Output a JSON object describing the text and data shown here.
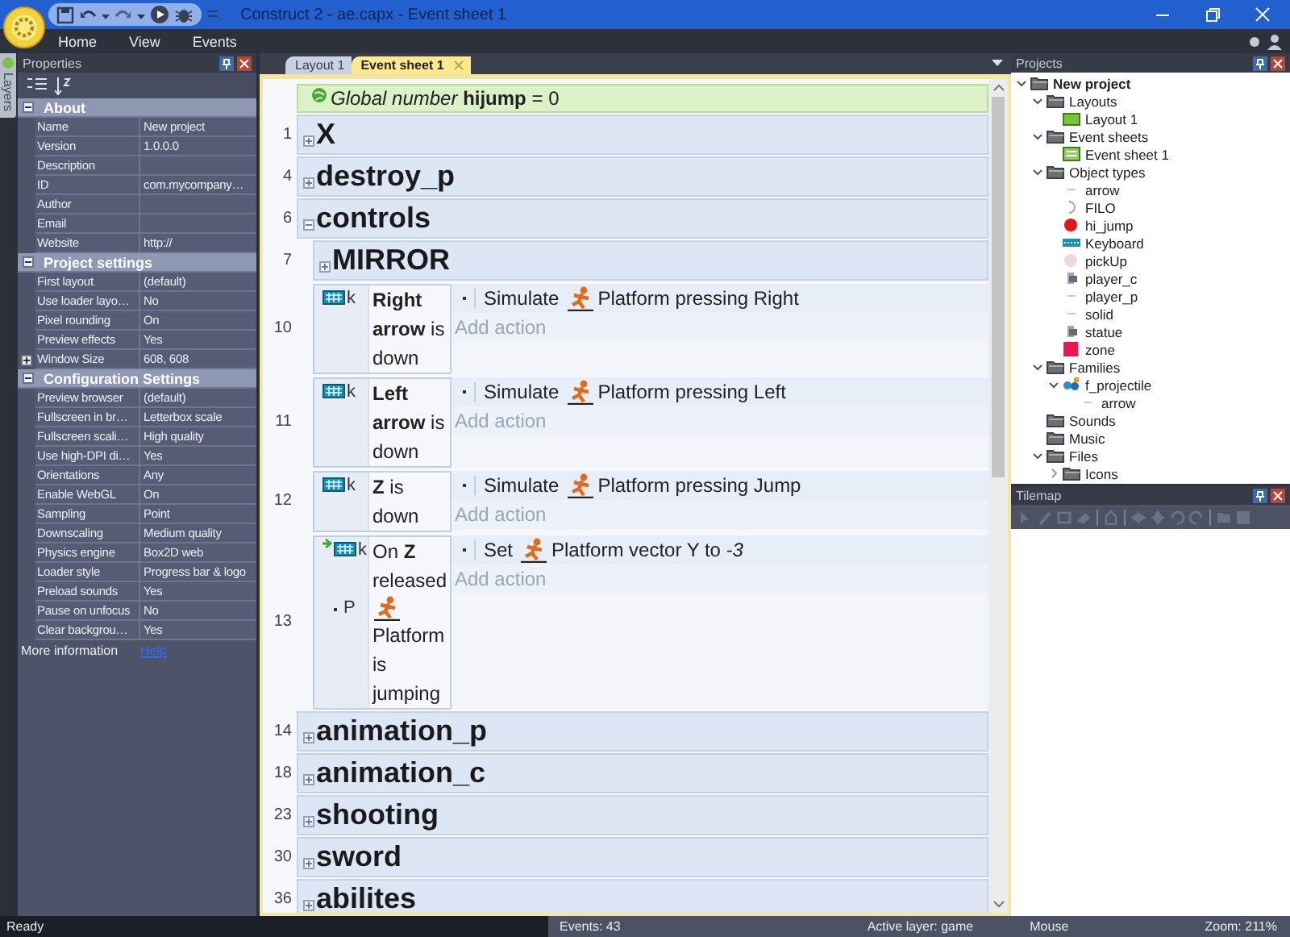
{
  "title_bar": {
    "title": "Construct 2 - ae.capx - Event sheet 1"
  },
  "menu": [
    "Home",
    "View",
    "Events"
  ],
  "side_tab": "Layers",
  "properties": {
    "title": "Properties",
    "sections": [
      {
        "title": "About",
        "expanded": true,
        "rows": [
          {
            "name": "Name",
            "value": "New project"
          },
          {
            "name": "Version",
            "value": "1.0.0.0"
          },
          {
            "name": "Description"
          },
          {
            "name": "ID",
            "value": "com.mycompany…"
          },
          {
            "name": "Author"
          },
          {
            "name": "Email"
          },
          {
            "name": "Website",
            "value": "http://"
          }
        ]
      },
      {
        "title": "Project settings",
        "expanded": true,
        "rows": [
          {
            "name": "First layout",
            "value": "(default)"
          },
          {
            "name": "Use loader layo…",
            "value": "No"
          },
          {
            "name": "Pixel rounding",
            "value": "On"
          },
          {
            "name": "Preview effects",
            "value": "Yes"
          },
          {
            "name": "Window Size",
            "value": "608, 608",
            "expanded": false
          }
        ]
      },
      {
        "title": "Configuration Settings",
        "expanded": true,
        "rows": [
          {
            "name": "Preview browser",
            "value": "(default)"
          },
          {
            "name": "Fullscreen in br…",
            "value": "Letterbox scale"
          },
          {
            "name": "Fullscreen scali…",
            "value": "High quality"
          },
          {
            "name": "Use high-DPI di…",
            "value": "Yes"
          },
          {
            "name": "Orientations",
            "value": "Any"
          },
          {
            "name": "Enable WebGL",
            "value": "On"
          },
          {
            "name": "Sampling",
            "value": "Point"
          },
          {
            "name": "Downscaling",
            "value": "Medium quality"
          },
          {
            "name": "Physics engine",
            "value": "Box2D web"
          },
          {
            "name": "Loader style",
            "value": "Progress bar & logo"
          },
          {
            "name": "Preload sounds",
            "value": "Yes"
          },
          {
            "name": "Pause on unfocus",
            "value": "No"
          },
          {
            "name": "Clear backgrou…",
            "value": "Yes"
          }
        ]
      }
    ],
    "more_info": {
      "label": "More information",
      "link": "Help"
    }
  },
  "tabs": [
    {
      "label": "Layout 1",
      "selected": false
    },
    {
      "label": "Event sheet 1",
      "selected": true
    }
  ],
  "event_sheet": {
    "rows": [
      {
        "kind": "global",
        "text": "*Global number* **hijump** = 0"
      },
      {
        "kind": "group",
        "line": "1",
        "title": "X",
        "expanded": false
      },
      {
        "kind": "group",
        "line": "4",
        "title": "destroy_p",
        "expanded": false
      },
      {
        "kind": "group",
        "line": "6",
        "title": "controls",
        "expanded": true,
        "children": [
          {
            "kind": "group",
            "line": "7",
            "title": "MIRROR",
            "expanded": false
          },
          {
            "kind": "event",
            "line": "10",
            "conditions": [
              {
                "object": "k",
                "kind": "keyboard",
                "trigger": false,
                "text": "**Right arrow** is down"
              }
            ],
            "actions": [
              {
                "verb": "Simulate",
                "text": "Platform pressing Right"
              }
            ],
            "add_action": "Add action"
          },
          {
            "kind": "event",
            "line": "11",
            "conditions": [
              {
                "object": "k",
                "kind": "keyboard",
                "trigger": false,
                "text": "**Left arrow** is down"
              }
            ],
            "actions": [
              {
                "verb": "Simulate",
                "text": "Platform pressing Left"
              }
            ],
            "add_action": "Add action"
          },
          {
            "kind": "event",
            "line": "12",
            "conditions": [
              {
                "object": "k",
                "kind": "keyboard",
                "trigger": false,
                "text": "**Z** is down"
              }
            ],
            "actions": [
              {
                "verb": "Simulate",
                "text": "Platform pressing Jump"
              }
            ],
            "add_action": "Add action"
          },
          {
            "kind": "event",
            "line": "13",
            "conditions": [
              {
                "object": "k",
                "kind": "keyboard",
                "trigger": true,
                "text": "On **Z** released"
              },
              {
                "object": "P",
                "kind": "platform",
                "trigger": false,
                "text": "Platform is jumping"
              }
            ],
            "actions": [
              {
                "verb": "Set",
                "text": "Platform vector Y to *-3*"
              }
            ],
            "add_action": "Add action"
          }
        ]
      },
      {
        "kind": "group",
        "line": "14",
        "title": "animation_p",
        "expanded": false
      },
      {
        "kind": "group",
        "line": "18",
        "title": "animation_c",
        "expanded": false
      },
      {
        "kind": "group",
        "line": "23",
        "title": "shooting",
        "expanded": false
      },
      {
        "kind": "group",
        "line": "30",
        "title": "sword",
        "expanded": false
      },
      {
        "kind": "group",
        "line": "36",
        "title": "abilites",
        "expanded": false
      }
    ]
  },
  "projects": {
    "title": "Projects",
    "tree": [
      {
        "label": "New project",
        "kind": "folder",
        "expanded": true,
        "children": [
          {
            "label": "Layouts",
            "kind": "folder",
            "expanded": true,
            "children": [
              {
                "label": "Layout 1",
                "kind": "layout"
              }
            ]
          },
          {
            "label": "Event sheets",
            "kind": "folder",
            "expanded": true,
            "children": [
              {
                "label": "Event sheet 1",
                "kind": "sheet"
              }
            ]
          },
          {
            "label": "Object types",
            "kind": "folder",
            "expanded": true,
            "children": [
              {
                "label": "arrow",
                "kind": "mark"
              },
              {
                "label": "FILO",
                "kind": "crescent"
              },
              {
                "label": "hi_jump",
                "kind": "ball"
              },
              {
                "label": "Keyboard",
                "kind": "keyboard"
              },
              {
                "label": "pickUp",
                "kind": "dot"
              },
              {
                "label": "player_c",
                "kind": "figure"
              },
              {
                "label": "player_p",
                "kind": "mark"
              },
              {
                "label": "solid",
                "kind": "mark"
              },
              {
                "label": "statue",
                "kind": "figure"
              },
              {
                "label": "zone",
                "kind": "square"
              }
            ]
          },
          {
            "label": "Families",
            "kind": "folder",
            "expanded": true,
            "children": [
              {
                "label": "f_projectile",
                "kind": "family",
                "expanded": true,
                "children": [
                  {
                    "label": "arrow",
                    "kind": "mark"
                  }
                ]
              }
            ]
          },
          {
            "label": "Sounds",
            "kind": "folder"
          },
          {
            "label": "Music",
            "kind": "folder"
          },
          {
            "label": "Files",
            "kind": "folder",
            "expanded": true,
            "children": [
              {
                "label": "Icons",
                "kind": "folder",
                "expanded": false
              }
            ]
          }
        ]
      }
    ]
  },
  "tilemap": {
    "title": "Tilemap"
  },
  "status_bar": {
    "state": "Ready",
    "events": "Events: 43",
    "layer": "Active layer: game",
    "mode": "Mouse",
    "zoom": "Zoom: 211%"
  }
}
